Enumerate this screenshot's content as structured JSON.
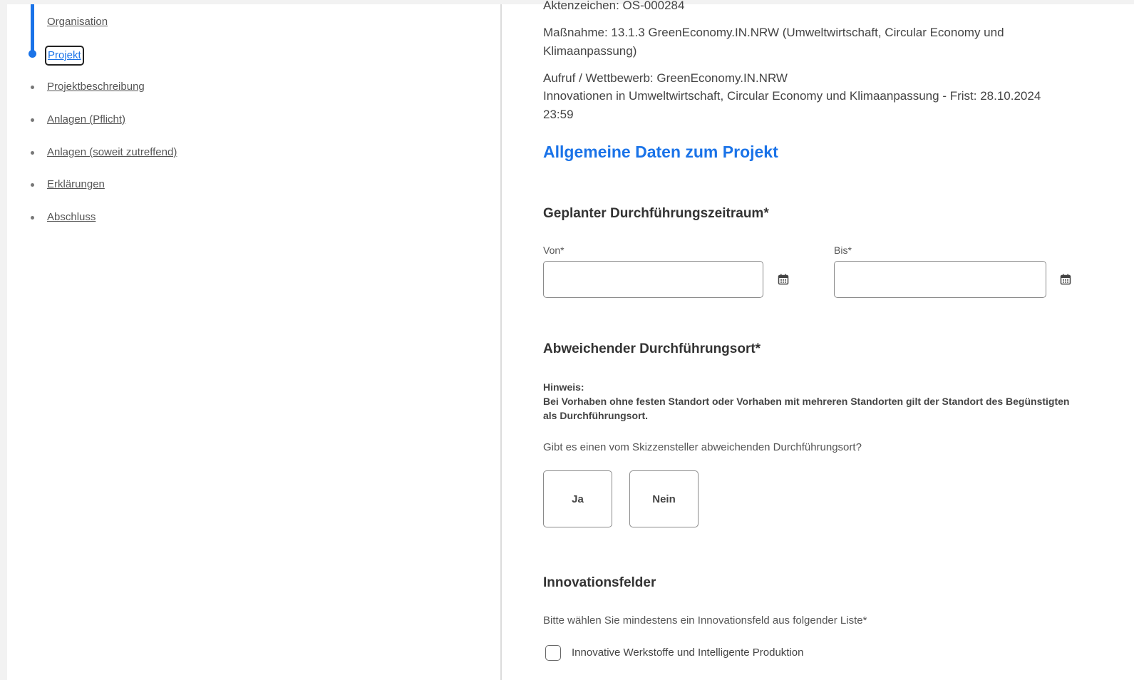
{
  "nav": {
    "items": [
      {
        "label": "Organisation",
        "state": "done"
      },
      {
        "label": "Projekt",
        "state": "active"
      },
      {
        "label": "Projektbeschreibung",
        "state": "pending"
      },
      {
        "label": "Anlagen (Pflicht)",
        "state": "pending"
      },
      {
        "label": "Anlagen (soweit zutreffend)",
        "state": "pending"
      },
      {
        "label": "Erklärungen",
        "state": "pending"
      },
      {
        "label": "Abschluss",
        "state": "pending"
      }
    ]
  },
  "header": {
    "aktenzeichen": "Aktenzeichen: OS-000284",
    "massnahme": "Maßnahme: 13.1.3 GreenEconomy.IN.NRW (Umweltwirtschaft, Circular Economy und Klimaanpassung)",
    "aufruf_line1": "Aufruf / Wettbewerb: GreenEconomy.IN.NRW",
    "aufruf_line2": "Innovationen in Umweltwirtschaft, Circular Economy und Klimaanpassung - Frist: 28.10.2024 23:59"
  },
  "main": {
    "section_title": "Allgemeine Daten zum Projekt",
    "zeitraum": {
      "heading": "Geplanter Durchführungszeitraum*",
      "von_label": "Von*",
      "von_value": "",
      "bis_label": "Bis*",
      "bis_value": ""
    },
    "ort": {
      "heading": "Abweichender Durchführungsort*",
      "hint_title": "Hinweis:",
      "hint_text": "Bei Vorhaben ohne festen Standort oder Vorhaben mit mehreren Standorten gilt der Standort des Begünstigten als Durchführungsort.",
      "question": "Gibt es einen vom Skizzensteller abweichenden Durchführungsort?",
      "yes_label": "Ja",
      "no_label": "Nein"
    },
    "innovationsfelder": {
      "heading": "Innovationsfelder",
      "instruction": "Bitte wählen Sie mindestens ein Innovationsfeld aus folgender Liste*",
      "options": [
        {
          "label": "Innovative Werkstoffe und Intelligente Produktion",
          "checked": false
        }
      ]
    }
  },
  "colors": {
    "accent": "#1a73e8",
    "text": "#444444",
    "border": "#8a8a8a"
  }
}
